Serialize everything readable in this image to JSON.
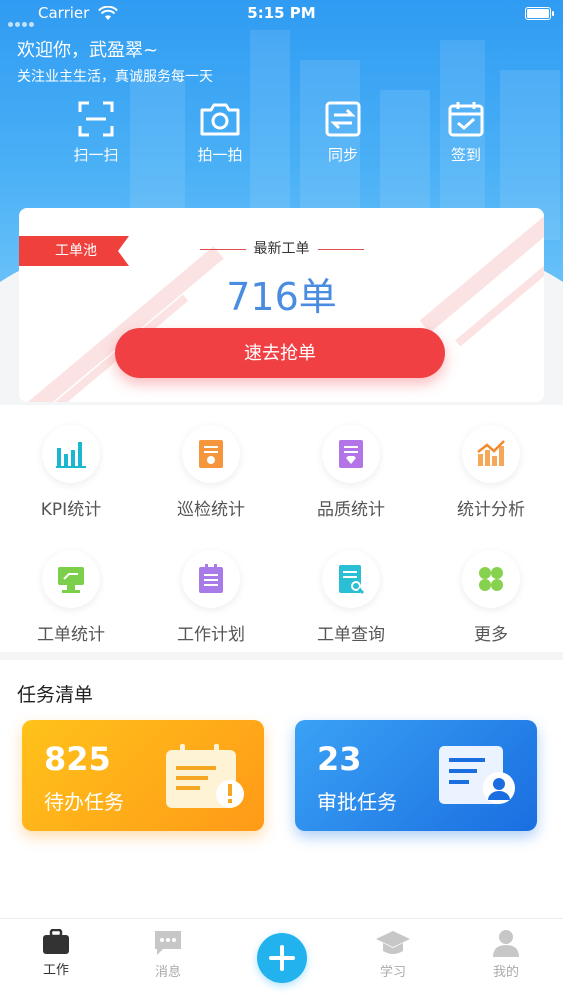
{
  "status_bar": {
    "carrier": "Carrier",
    "time": "5:15 PM"
  },
  "header": {
    "greeting": "欢迎你，武盈翠~",
    "subtitle": "关注业主生活，真诚服务每一天",
    "quick_actions": [
      {
        "label": "扫一扫",
        "icon": "scan-icon"
      },
      {
        "label": "拍一拍",
        "icon": "camera-icon"
      },
      {
        "label": "同步",
        "icon": "sync-icon"
      },
      {
        "label": "签到",
        "icon": "checkin-icon"
      }
    ]
  },
  "work_order_pool": {
    "badge": "工单池",
    "caption": "最新工单",
    "count": "716单",
    "button": "速去抢单"
  },
  "grid": {
    "items": [
      {
        "label": "KPI统计",
        "icon": "kpi-chart-icon"
      },
      {
        "label": "巡检统计",
        "icon": "inspection-icon"
      },
      {
        "label": "品质统计",
        "icon": "quality-icon"
      },
      {
        "label": "统计分析",
        "icon": "analysis-icon"
      },
      {
        "label": "工单统计",
        "icon": "order-stats-icon"
      },
      {
        "label": "工作计划",
        "icon": "plan-icon"
      },
      {
        "label": "工单查询",
        "icon": "order-query-icon"
      },
      {
        "label": "更多",
        "icon": "more-icon"
      }
    ]
  },
  "tasks": {
    "title": "任务清单",
    "cards": [
      {
        "count": "825",
        "label": "待办任务",
        "icon": "calendar-alert-icon"
      },
      {
        "count": "23",
        "label": "审批任务",
        "icon": "approval-icon"
      }
    ]
  },
  "tab_bar": {
    "items": [
      {
        "label": "工作",
        "icon": "briefcase-icon",
        "active": true
      },
      {
        "label": "消息",
        "icon": "message-icon"
      },
      {
        "label": "",
        "icon": "plus-icon"
      },
      {
        "label": "学习",
        "icon": "graduation-cap-icon"
      },
      {
        "label": "我的",
        "icon": "person-icon"
      }
    ]
  },
  "colors": {
    "header_blue": "#2f9bf2",
    "accent_red": "#f04044",
    "count_blue": "#4a8ce0",
    "todo_orange": "#ffa21a",
    "approval_blue": "#1f7fe8",
    "plus_cyan": "#22b3ee"
  }
}
